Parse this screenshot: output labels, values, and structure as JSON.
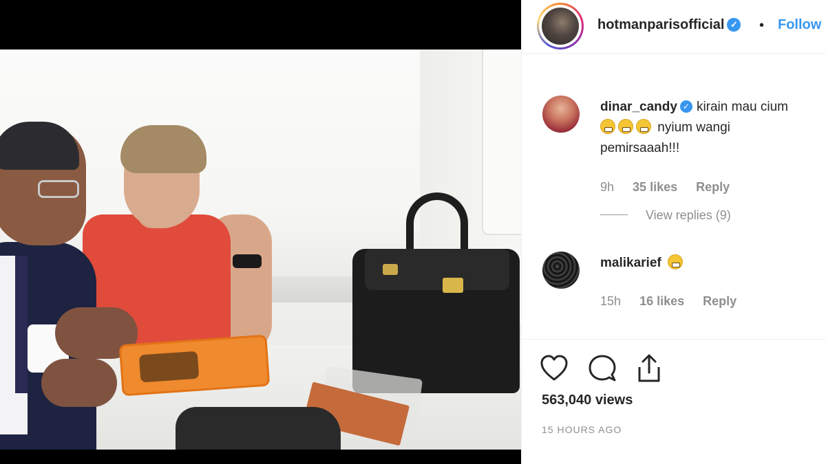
{
  "post": {
    "username": "hotmanparisofficial",
    "separator": "•",
    "follow_label": "Follow",
    "views": "563,040 views",
    "time_ago": "15 HOURS AGO"
  },
  "comments": [
    {
      "username": "dinar_candy",
      "verified": true,
      "text_line1": "kirain mau cium",
      "text_line2": "nyium wangi",
      "text_line3": "pemirsaaah!!!",
      "emoji_count": 3,
      "time": "9h",
      "likes": "35 likes",
      "reply_label": "Reply",
      "view_replies": "View replies (9)"
    },
    {
      "username": "malikarief",
      "verified": false,
      "emoji_count": 1,
      "time": "15h",
      "likes": "16 likes",
      "reply_label": "Reply"
    }
  ],
  "icons": {
    "like": "heart-icon",
    "comment": "comment-icon",
    "share": "share-icon",
    "verified": "verified-badge-icon"
  },
  "colors": {
    "link_blue": "#3897f0",
    "text": "#262626",
    "muted": "#8e8e8e"
  }
}
